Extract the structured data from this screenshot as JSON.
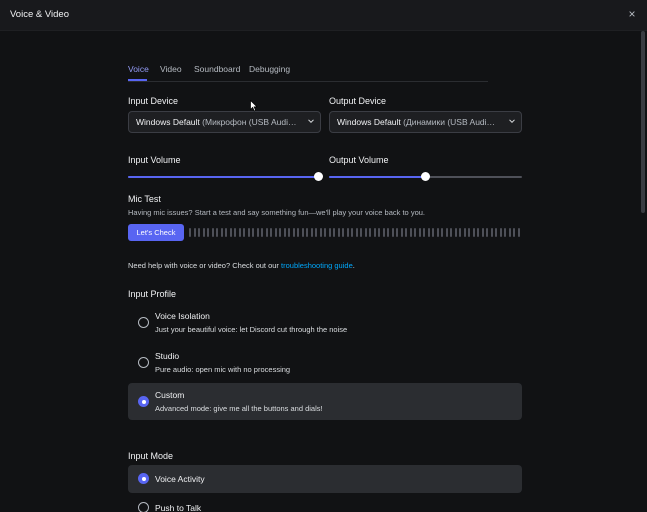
{
  "window": {
    "title": "Voice & Video",
    "close_icon": "×"
  },
  "tabs": [
    "Voice",
    "Video",
    "Soundboard",
    "Debugging"
  ],
  "input_device": {
    "label": "Input Device",
    "value_main": "Windows Default",
    "value_detail": "(Микрофон (USB Audi…"
  },
  "output_device": {
    "label": "Output Device",
    "value_main": "Windows Default",
    "value_detail": "(Динамики (USB Audi…"
  },
  "input_volume": {
    "label": "Input Volume",
    "level": 1.0
  },
  "output_volume": {
    "label": "Output Volume",
    "level": 0.5
  },
  "mic_test": {
    "label": "Mic Test",
    "description": "Having mic issues? Start a test and say something fun—we'll play your voice back to you.",
    "button": "Let's Check"
  },
  "help": {
    "text": "Need help with voice or video? Check out our ",
    "link": "troubleshooting guide",
    "suffix": "."
  },
  "input_profile": {
    "title": "Input Profile",
    "options": [
      {
        "title": "Voice Isolation",
        "desc": "Just your beautiful voice: let Discord cut through the noise",
        "selected": false
      },
      {
        "title": "Studio",
        "desc": "Pure audio: open mic with no processing",
        "selected": false
      },
      {
        "title": "Custom",
        "desc": "Advanced mode: give me all the buttons and dials!",
        "selected": true
      }
    ]
  },
  "input_mode": {
    "title": "Input Mode",
    "options": [
      {
        "title": "Voice Activity",
        "selected": true
      },
      {
        "title": "Push to Talk",
        "selected": false
      }
    ]
  },
  "colors": {
    "accent": "#5865f2",
    "background": "#111214",
    "link": "#00a8fc"
  }
}
